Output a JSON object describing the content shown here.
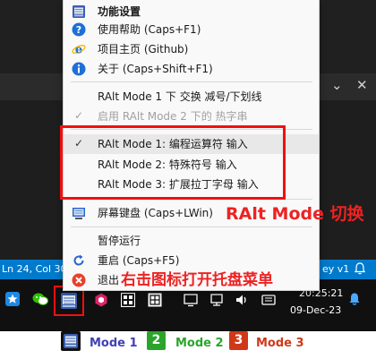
{
  "menu": {
    "header_label": "功能设置",
    "help_label": "使用帮助 (Caps+F1)",
    "homepage_label": "项目主页 (Github)",
    "about_label": "关于 (Caps+Shift+F1)",
    "ralt_swap_label": "RAlt Mode 1 下 交换 减号/下划线",
    "ralt_hotstring_label": "启用 RAlt Mode 2 下的 热字串",
    "mode1_label": "RAlt Mode 1: 编程运算符 输入",
    "mode2_label": "RAlt Mode 2: 特殊符号 输入",
    "mode3_label": "RAlt Mode 3: 扩展拉丁字母 输入",
    "osk_label": "屏幕键盘 (Caps+LWin)",
    "pause_label": "暂停运行",
    "restart_label": "重启 (Caps+F5)",
    "exit_label": "退出",
    "check_glyph": "✓"
  },
  "editor": {
    "status_position": "Ln 24, Col 30",
    "status_right": "ey v1"
  },
  "taskbar": {
    "clock_time": "20:25:21",
    "clock_date": "09-Dec-23"
  },
  "annotations": {
    "ralt_switch": "RAlt Mode 切换",
    "right_click_hint": "右击图标打开托盘菜单"
  },
  "legend": {
    "mode1_label": "Mode 1",
    "mode2_num": "2",
    "mode2_label": "Mode 2",
    "mode3_num": "3",
    "mode3_label": "Mode 3"
  },
  "colors": {
    "mode1": "#4040b8",
    "mode2": "#2aa52a",
    "mode3": "#d03818",
    "annotation_red": "#ee2222",
    "status_blue": "#007acc"
  },
  "icons": {
    "header": "keyboard-icon",
    "help": "question-icon",
    "homepage": "ie-browser-icon",
    "about": "info-icon",
    "osk": "screen-keyboard-icon",
    "restart": "restart-icon",
    "exit": "exit-icon"
  }
}
